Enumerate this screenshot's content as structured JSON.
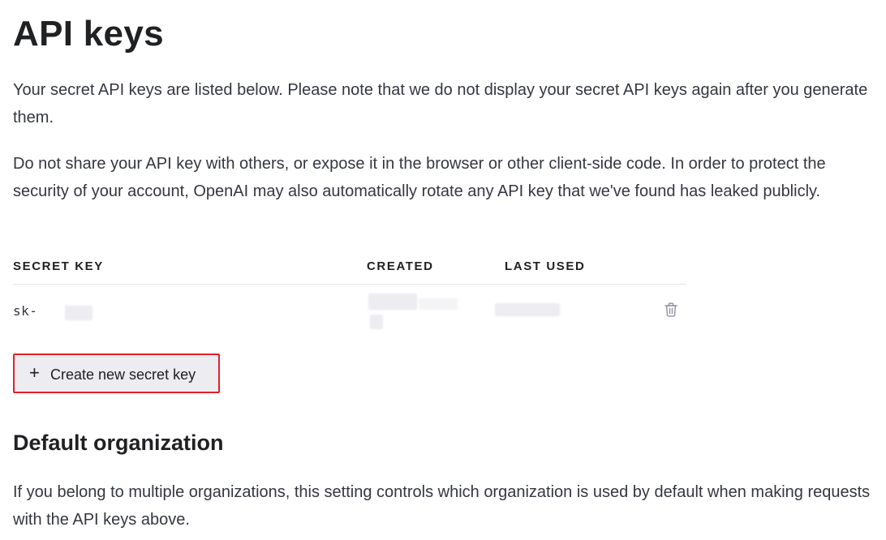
{
  "header": {
    "title": "API keys"
  },
  "intro": {
    "paragraph1": "Your secret API keys are listed below. Please note that we do not display your secret API keys again after you generate them.",
    "paragraph2": "Do not share your API key with others, or expose it in the browser or other client-side code. In order to protect the security of your account, OpenAI may also automatically rotate any API key that we've found has leaked publicly."
  },
  "keys_table": {
    "columns": [
      "SECRET KEY",
      "CREATED",
      "LAST USED"
    ],
    "rows": [
      {
        "secret_key": "sk-",
        "created": "",
        "last_used": "",
        "delete_icon": "trash-icon"
      }
    ]
  },
  "actions": {
    "create_label": "Create new secret key",
    "create_icon": "+",
    "highlight_color": "#e4202a"
  },
  "default_org": {
    "title": "Default organization",
    "description": "If you belong to multiple organizations, this setting controls which organization is used by default when making requests with the API keys above."
  },
  "colors": {
    "text": "#353740",
    "heading": "#202123",
    "button_bg": "#ececf1",
    "divider": "#e5e5e7"
  }
}
